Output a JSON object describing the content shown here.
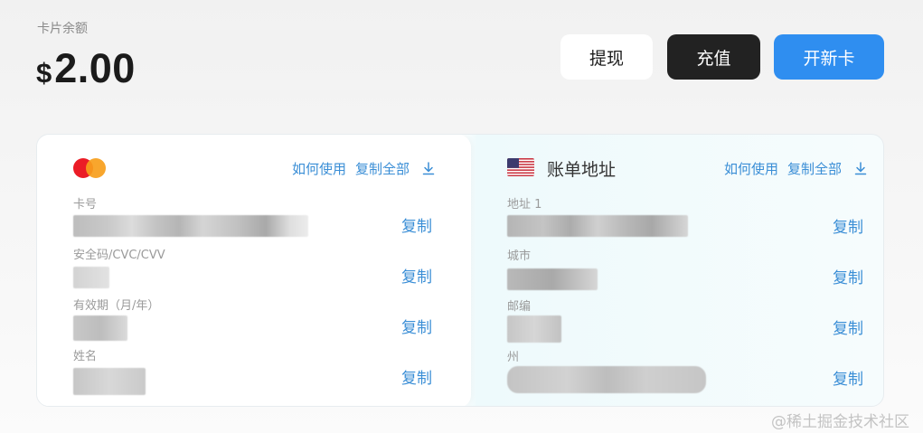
{
  "balance": {
    "label": "卡片余额",
    "currency": "$",
    "amount": "2.00"
  },
  "actions": {
    "withdraw": "提现",
    "recharge": "充值",
    "new_card": "开新卡"
  },
  "card": {
    "brand_icon": "mastercard-icon",
    "how_to_use": "如何使用",
    "copy_all": "复制全部",
    "fields": [
      {
        "label": "卡号",
        "copy": "复制"
      },
      {
        "label": "安全码/CVC/CVV",
        "copy": "复制"
      },
      {
        "label": "有效期（月/年）",
        "copy": "复制"
      },
      {
        "label": "姓名",
        "copy": "复制"
      }
    ]
  },
  "billing": {
    "flag_icon": "us-flag-icon",
    "title": "账单地址",
    "how_to_use": "如何使用",
    "copy_all": "复制全部",
    "fields": [
      {
        "label": "地址 1",
        "copy": "复制"
      },
      {
        "label": "城市",
        "copy": "复制"
      },
      {
        "label": "邮编",
        "copy": "复制"
      },
      {
        "label": "州",
        "copy": "复制"
      }
    ]
  },
  "watermark": "@稀土掘金技术社区",
  "colors": {
    "accent_blue": "#2f8ef0",
    "link_blue": "#3a8ed6",
    "dark_button": "#222222"
  }
}
